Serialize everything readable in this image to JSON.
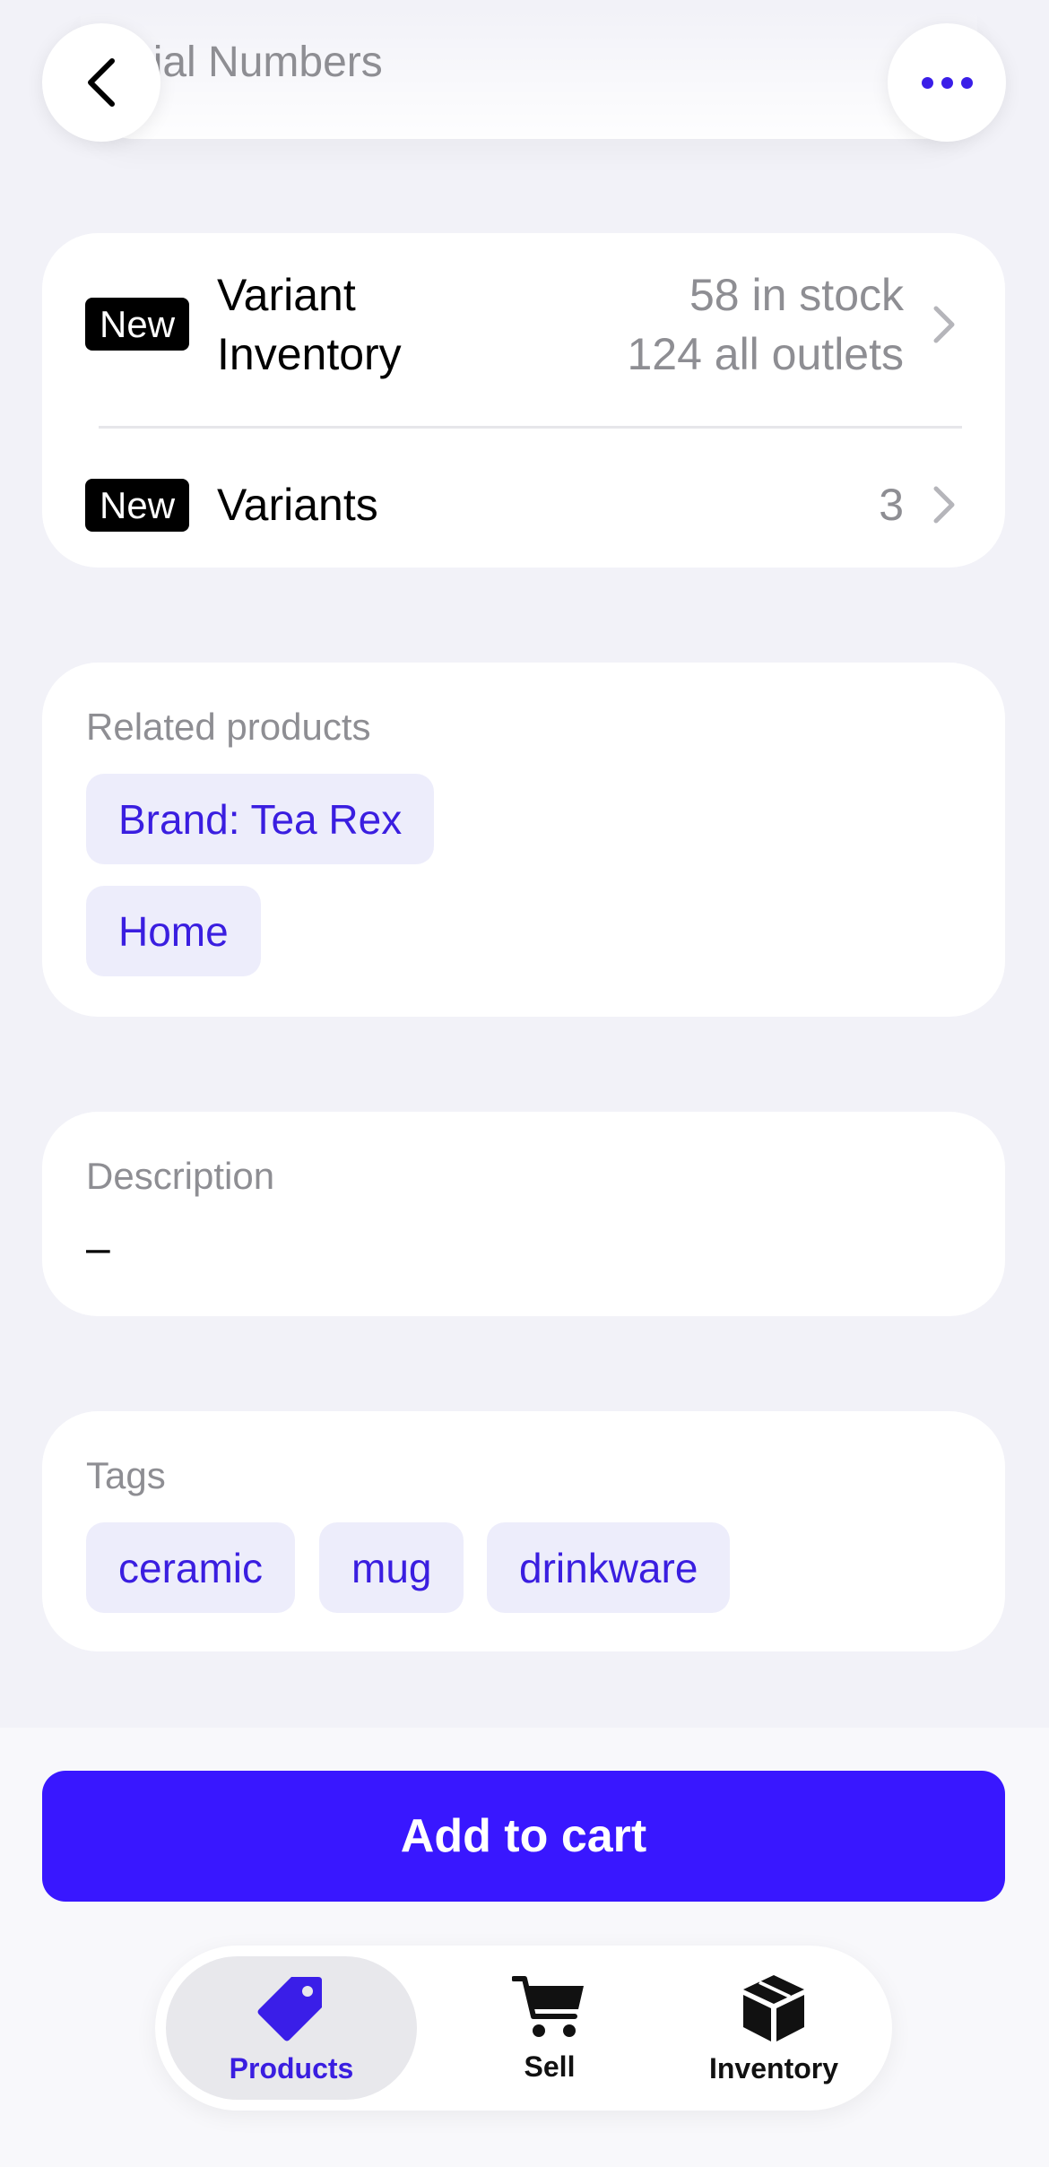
{
  "header": {
    "title": "Serial Numbers",
    "back_icon": "chevron-left-icon",
    "more_icon": "ellipsis-icon"
  },
  "inventory_card": {
    "variant_inventory": {
      "badge": "New",
      "label_line1": "Variant",
      "label_line2": "Inventory",
      "in_stock": "58 in stock",
      "all_outlets": "124 all outlets"
    },
    "variants": {
      "badge": "New",
      "label": "Variants",
      "count": "3"
    }
  },
  "related_products": {
    "label": "Related products",
    "chips": [
      "Brand: Tea Rex",
      "Home"
    ]
  },
  "description": {
    "label": "Description",
    "value": "–"
  },
  "tags": {
    "label": "Tags",
    "chips": [
      "ceramic",
      "mug",
      "drinkware"
    ]
  },
  "cta": {
    "label": "Add to cart"
  },
  "tabbar": {
    "items": [
      {
        "label": "Products",
        "icon": "tag-icon",
        "active": true
      },
      {
        "label": "Sell",
        "icon": "cart-icon",
        "active": false
      },
      {
        "label": "Inventory",
        "icon": "box-icon",
        "active": false
      }
    ]
  },
  "colors": {
    "accent": "#3917ff",
    "chip_bg": "#ededfb",
    "chip_text": "#3a1ee0",
    "background": "#f2f2f8"
  }
}
